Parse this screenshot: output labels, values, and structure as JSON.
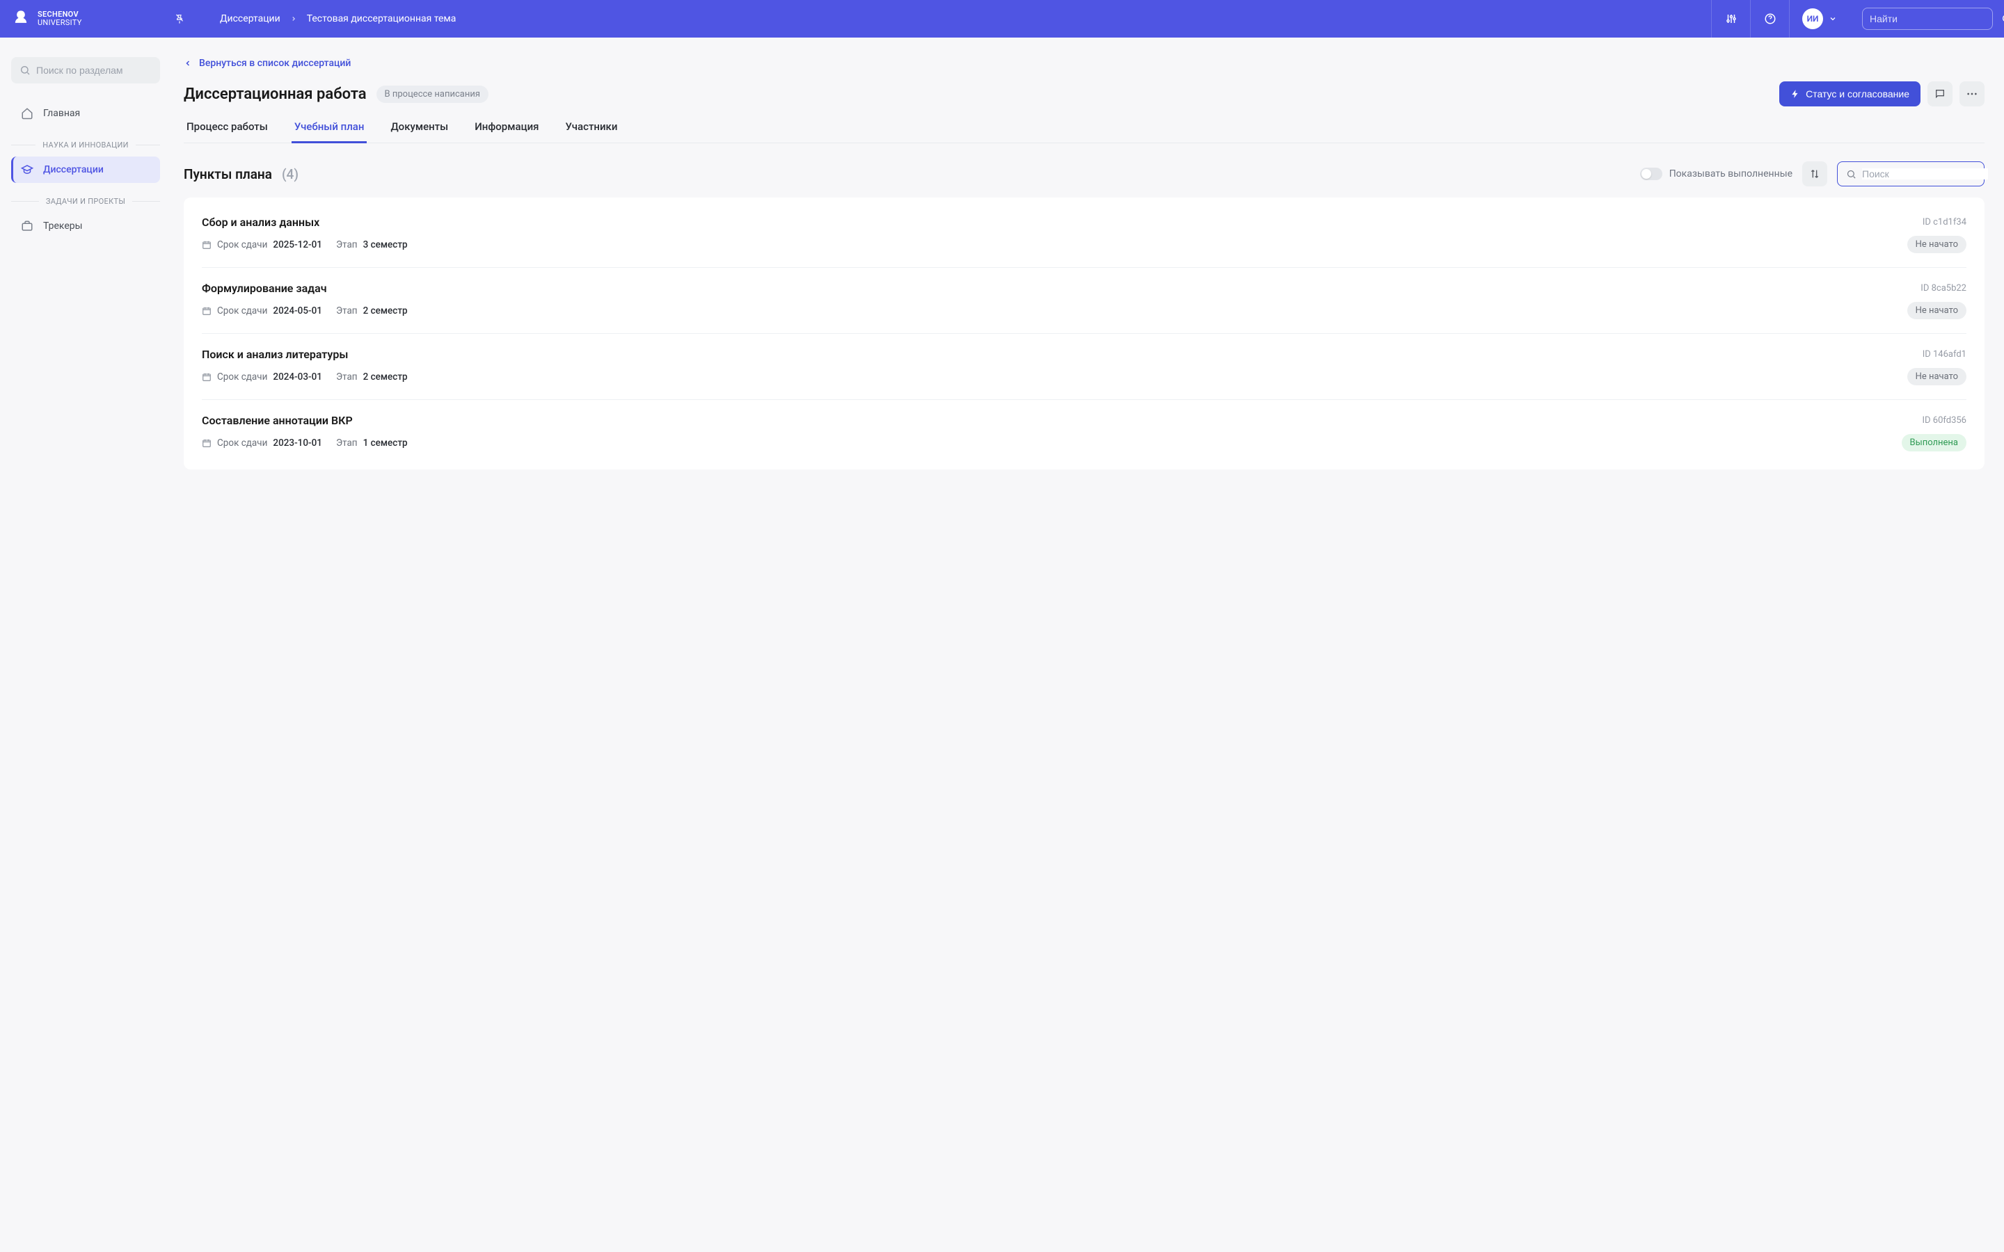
{
  "header": {
    "logo_line1": "SECHENOV",
    "logo_line2": "UNIVERSITY",
    "breadcrumb": [
      "Диссертации",
      "Тестовая диссертационная тема"
    ],
    "avatar_initials": "ИИ",
    "search_placeholder": "Найти"
  },
  "sidebar": {
    "search_placeholder": "Поиск по разделам",
    "items": [
      {
        "label": "Главная",
        "icon": "home"
      }
    ],
    "section1_label": "НАУКА И ИННОВАЦИИ",
    "section1_items": [
      {
        "label": "Диссертации",
        "icon": "graduation",
        "active": true
      }
    ],
    "section2_label": "ЗАДАЧИ И ПРОЕКТЫ",
    "section2_items": [
      {
        "label": "Трекеры",
        "icon": "briefcase"
      }
    ]
  },
  "main": {
    "back_label": "Вернуться в список диссертаций",
    "page_title": "Диссертационная работа",
    "status_pill": "В процессе написания",
    "primary_action": "Статус и согласование",
    "tabs": [
      "Процесс работы",
      "Учебный план",
      "Документы",
      "Информация",
      "Участники"
    ],
    "active_tab_index": 1,
    "plan_title": "Пункты плана",
    "plan_count_label": "(4)",
    "toggle_label": "Показывать выполненные",
    "plan_search_placeholder": "Поиск",
    "meta_due_label": "Срок сдачи",
    "meta_stage_label": "Этап",
    "id_prefix": "ID",
    "items": [
      {
        "title": "Сбор и анализ данных",
        "due": "2025-12-01",
        "stage": "3 семестр",
        "id": "c1d1f34",
        "status": "Не начато",
        "status_kind": "not-started"
      },
      {
        "title": "Формулирование задач",
        "due": "2024-05-01",
        "stage": "2 семестр",
        "id": "8ca5b22",
        "status": "Не начато",
        "status_kind": "not-started"
      },
      {
        "title": "Поиск и анализ литературы",
        "due": "2024-03-01",
        "stage": "2 семестр",
        "id": "146afd1",
        "status": "Не начато",
        "status_kind": "not-started"
      },
      {
        "title": "Составление аннотации ВКР",
        "due": "2023-10-01",
        "stage": "1 семестр",
        "id": "60fd356",
        "status": "Выполнена",
        "status_kind": "done"
      }
    ]
  }
}
